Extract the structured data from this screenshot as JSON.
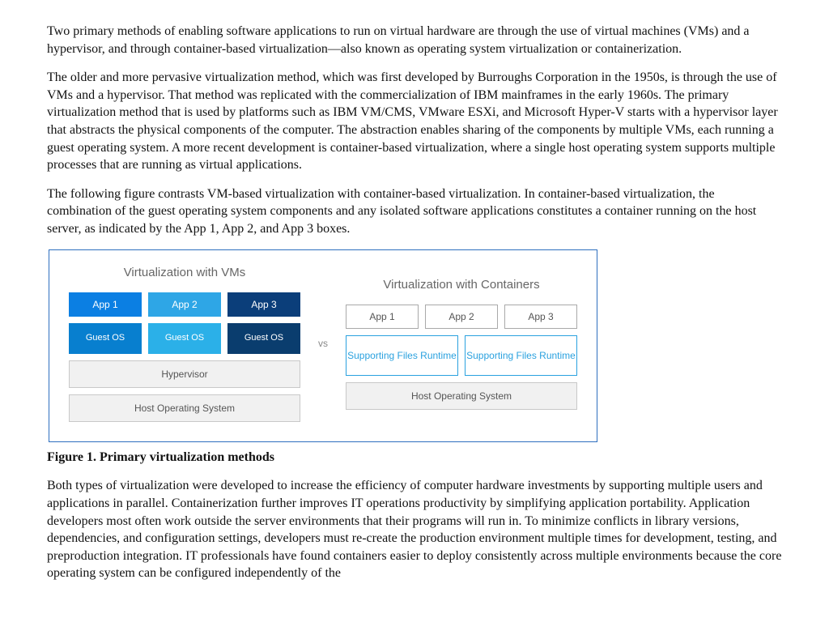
{
  "paragraphs": {
    "p1": "Two primary methods of enabling software applications to run on virtual hardware are through the use of virtual machines (VMs) and a hypervisor, and through container-based virtualization—also known as operating system virtualization or containerization.",
    "p2": "The older and more pervasive virtualization method, which was first developed by Burroughs Corporation in the 1950s, is through the use of VMs and a hypervisor. That method was replicated with the commercialization of IBM mainframes in the early 1960s. The primary virtualization method that is used by platforms such as IBM VM/CMS, VMware ESXi, and Microsoft Hyper-V starts with a hypervisor layer that abstracts the physical components of the computer. The abstraction enables sharing of the components by multiple VMs, each running a guest operating system. A more recent development is container-based virtualization, where a single host operating system supports multiple processes that are running as virtual applications.",
    "p3": "The following figure contrasts VM-based virtualization with container-based virtualization. In container-based virtualization, the combination of the guest operating system components and any isolated software applications constitutes a container running on the host server, as indicated by the App 1, App 2, and App 3 boxes.",
    "p4": "Both types of virtualization were developed to increase the efficiency of computer hardware investments by supporting multiple users and applications in parallel. Containerization further improves IT operations productivity by simplifying application portability. Application developers most often work outside the server environments that their programs will run in. To minimize conflicts in library versions, dependencies, and configuration settings, developers must re-create the production environment multiple times for development, testing, and preproduction integration. IT professionals have found containers easier to deploy consistently across multiple environments because the core operating system can be configured independently of the"
  },
  "figure_caption": "Figure 1. Primary virtualization methods",
  "diagram": {
    "left_title": "Virtualization with VMs",
    "right_title": "Virtualization with Containers",
    "vs": "vs",
    "vm_apps": [
      "App 1",
      "App 2",
      "App 3"
    ],
    "vm_guest": [
      "Guest OS",
      "Guest OS",
      "Guest OS"
    ],
    "hypervisor": "Hypervisor",
    "host_os_left": "Host Operating System",
    "c_apps": [
      "App 1",
      "App 2",
      "App 3"
    ],
    "support1": "Supporting Files Runtime",
    "support2": "Supporting Files Runtime",
    "host_os_right": "Host Operating System"
  }
}
